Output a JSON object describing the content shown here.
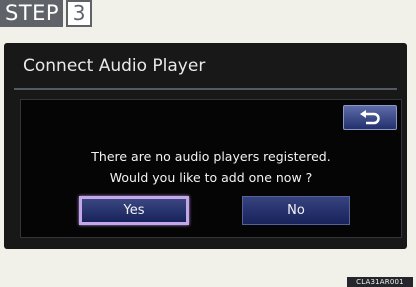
{
  "step": {
    "label": "STEP",
    "number": "3"
  },
  "screen": {
    "title": "Connect Audio Player",
    "dialog": {
      "back_icon": "return-arrow-icon",
      "message_line1": "There are no audio players registered.",
      "message_line2": "Would you like to add one now ?",
      "yes_label": "Yes",
      "no_label": "No"
    }
  },
  "image_code": "CLA31AR001",
  "colors": {
    "background": "#f1f1e9",
    "screen": "#181818",
    "button": "#22306e",
    "highlight": "#c4a7e8",
    "step_label": "#5f6369"
  }
}
